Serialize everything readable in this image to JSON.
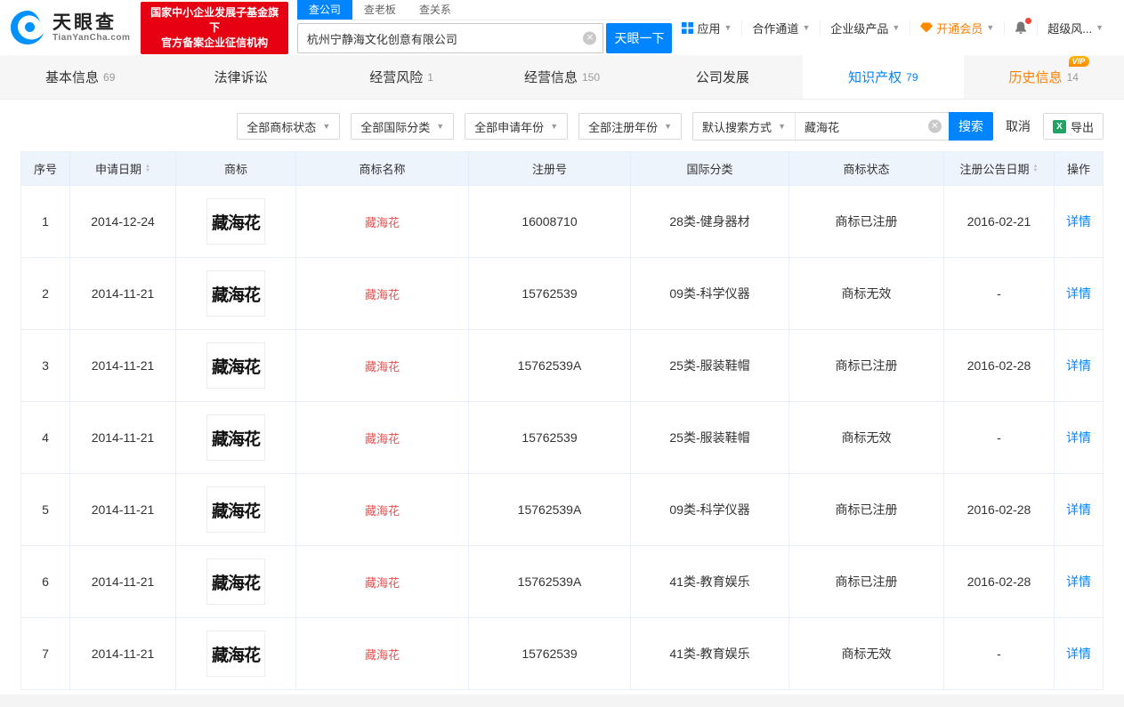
{
  "colors": {
    "accent_blue": "#0084ff",
    "badge_red": "#e60012",
    "keyword_red": "#e85050",
    "vip_orange": "#ff8000",
    "excel_green": "#21a366"
  },
  "brand": {
    "name": "天眼查",
    "domain": "TianYanCha.com",
    "cert_line1": "国家中小企业发展子基金旗下",
    "cert_line2": "官方备案企业征信机构"
  },
  "top_search": {
    "tabs": [
      {
        "label": "查公司"
      },
      {
        "label": "查老板"
      },
      {
        "label": "查关系"
      }
    ],
    "input_value": "杭州宁静海文化创意有限公司",
    "search_button": "天眼一下"
  },
  "top_menu": {
    "app": "应用",
    "cooperation": "合作通道",
    "enterprise": "企业级产品",
    "vip": "开通会员",
    "risk": "超级风..."
  },
  "nav_tabs": [
    {
      "label": "基本信息",
      "count": "69"
    },
    {
      "label": "法律诉讼",
      "count": ""
    },
    {
      "label": "经营风险",
      "count": "1"
    },
    {
      "label": "经营信息",
      "count": "150"
    },
    {
      "label": "公司发展",
      "count": ""
    },
    {
      "label": "知识产权",
      "count": "79"
    },
    {
      "label": "历史信息",
      "count": "14",
      "vip_tag": "VIP"
    }
  ],
  "filters": {
    "status": "全部商标状态",
    "intl_class": "全部国际分类",
    "apply_year": "全部申请年份",
    "reg_year": "全部注册年份",
    "search_mode": "默认搜索方式",
    "keyword": "藏海花",
    "search": "搜索",
    "cancel": "取消",
    "export": "导出"
  },
  "table": {
    "headers": [
      "序号",
      "申请日期",
      "商标",
      "商标名称",
      "注册号",
      "国际分类",
      "商标状态",
      "注册公告日期",
      "操作"
    ],
    "rows": [
      {
        "no": "1",
        "date": "2014-12-24",
        "mark": "藏海花",
        "name": "藏海花",
        "reg_no": "16008710",
        "class": "28类-健身器材",
        "status": "商标已注册",
        "pub_date": "2016-02-21",
        "action": "详情"
      },
      {
        "no": "2",
        "date": "2014-11-21",
        "mark": "藏海花",
        "name": "藏海花",
        "reg_no": "15762539",
        "class": "09类-科学仪器",
        "status": "商标无效",
        "pub_date": "-",
        "action": "详情"
      },
      {
        "no": "3",
        "date": "2014-11-21",
        "mark": "藏海花",
        "name": "藏海花",
        "reg_no": "15762539A",
        "class": "25类-服装鞋帽",
        "status": "商标已注册",
        "pub_date": "2016-02-28",
        "action": "详情"
      },
      {
        "no": "4",
        "date": "2014-11-21",
        "mark": "藏海花",
        "name": "藏海花",
        "reg_no": "15762539",
        "class": "25类-服装鞋帽",
        "status": "商标无效",
        "pub_date": "-",
        "action": "详情"
      },
      {
        "no": "5",
        "date": "2014-11-21",
        "mark": "藏海花",
        "name": "藏海花",
        "reg_no": "15762539A",
        "class": "09类-科学仪器",
        "status": "商标已注册",
        "pub_date": "2016-02-28",
        "action": "详情"
      },
      {
        "no": "6",
        "date": "2014-11-21",
        "mark": "藏海花",
        "name": "藏海花",
        "reg_no": "15762539A",
        "class": "41类-教育娱乐",
        "status": "商标已注册",
        "pub_date": "2016-02-28",
        "action": "详情"
      },
      {
        "no": "7",
        "date": "2014-11-21",
        "mark": "藏海花",
        "name": "藏海花",
        "reg_no": "15762539",
        "class": "41类-教育娱乐",
        "status": "商标无效",
        "pub_date": "-",
        "action": "详情"
      }
    ]
  }
}
